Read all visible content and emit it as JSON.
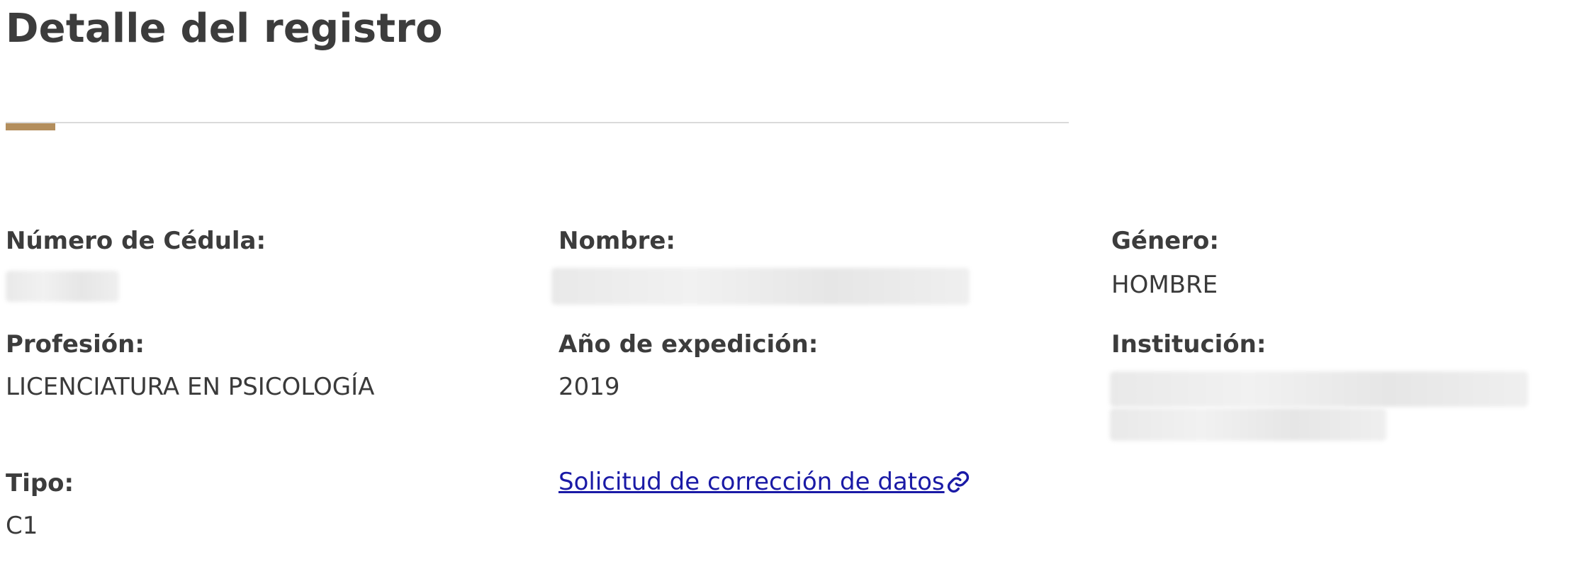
{
  "page": {
    "title": "Detalle del registro"
  },
  "colors": {
    "accent": "#b38e5d",
    "link": "#1a1aa6",
    "text": "#3a3a3a"
  },
  "fields": {
    "cedula": {
      "label": "Número de Cédula:",
      "value": ""
    },
    "nombre": {
      "label": "Nombre:",
      "value": ""
    },
    "genero": {
      "label": "Género:",
      "value": "HOMBRE"
    },
    "profesion": {
      "label": "Profesión:",
      "value": "LICENCIATURA EN PSICOLOGÍA"
    },
    "anio": {
      "label": "Año de expedición:",
      "value": "2019"
    },
    "institucion": {
      "label": "Institución:",
      "value": ""
    },
    "tipo": {
      "label": "Tipo:",
      "value": "C1"
    }
  },
  "links": {
    "correction": {
      "label": "Solicitud de corrección de datos",
      "icon": "link-icon"
    }
  }
}
